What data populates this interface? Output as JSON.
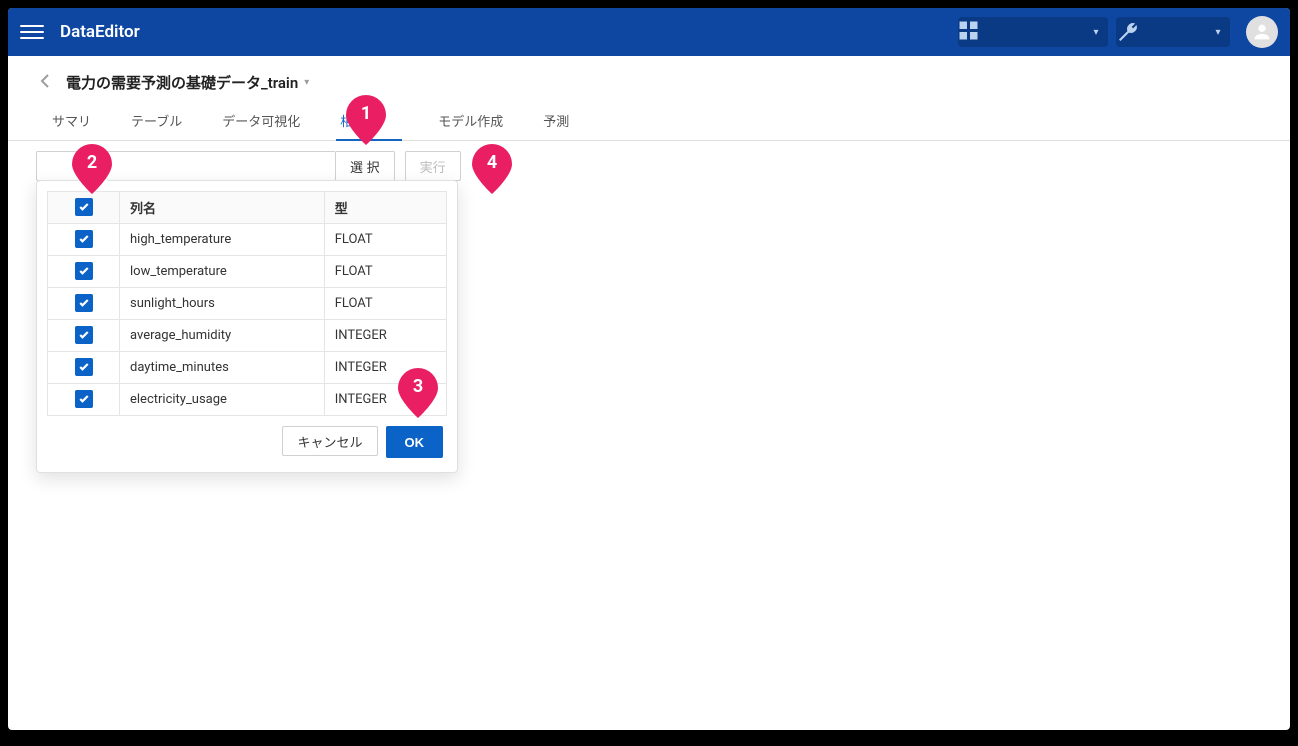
{
  "header": {
    "brand": "DataEditor"
  },
  "breadcrumb": {
    "title": "電力の需要予測の基礎データ_train"
  },
  "tabs": {
    "summary": "サマリ",
    "table": "テーブル",
    "viz": "データ可視化",
    "corr": "相関",
    "model": "モデル作成",
    "predict": "予測"
  },
  "controls": {
    "select": "選 択",
    "run": "実行"
  },
  "coltable": {
    "header_name": "列名",
    "header_type": "型",
    "rows": [
      {
        "name": "high_temperature",
        "type": "FLOAT"
      },
      {
        "name": "low_temperature",
        "type": "FLOAT"
      },
      {
        "name": "sunlight_hours",
        "type": "FLOAT"
      },
      {
        "name": "average_humidity",
        "type": "INTEGER"
      },
      {
        "name": "daytime_minutes",
        "type": "INTEGER"
      },
      {
        "name": "electricity_usage",
        "type": "INTEGER"
      }
    ]
  },
  "popover": {
    "cancel": "キャンセル",
    "ok": "OK"
  },
  "markers": {
    "m1": "1",
    "m2": "2",
    "m3": "3",
    "m4": "4"
  }
}
